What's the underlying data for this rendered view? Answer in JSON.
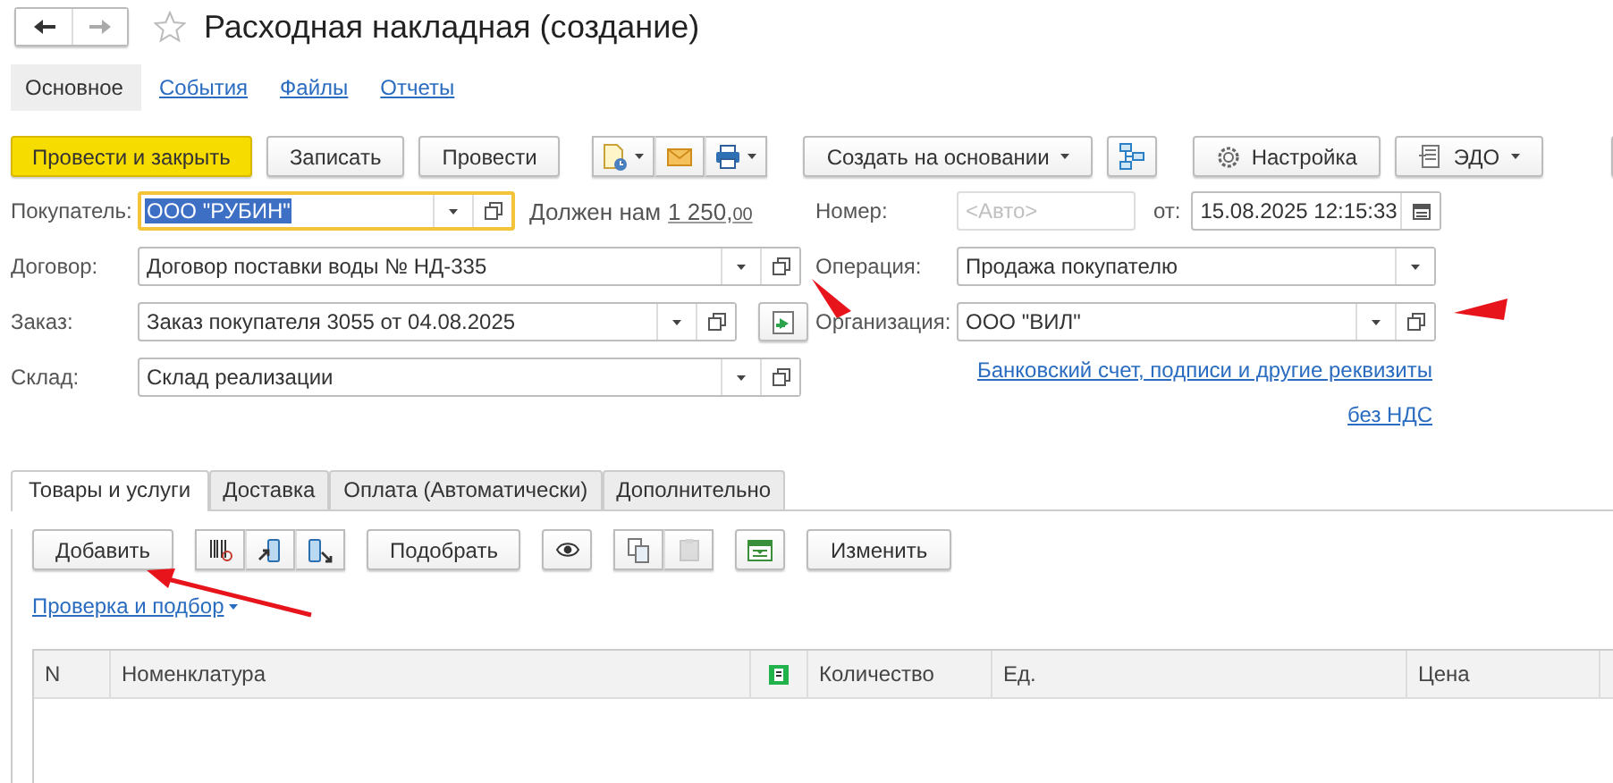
{
  "window": {
    "title": "Расходная накладная (создание)",
    "favorite": false
  },
  "nav_tabs": [
    {
      "label": "Основное",
      "selected": true
    },
    {
      "label": "События",
      "selected": false
    },
    {
      "label": "Файлы",
      "selected": false
    },
    {
      "label": "Отчеты",
      "selected": false
    }
  ],
  "toolbar": [
    {
      "kind": "primary",
      "label": "Провести и закрыть"
    },
    {
      "kind": "button",
      "label": "Записать"
    },
    {
      "kind": "button",
      "label": "Провести"
    },
    {
      "kind": "icon-group"
    },
    {
      "kind": "menu",
      "label": "Создать на основании"
    },
    {
      "kind": "structure"
    },
    {
      "kind": "settings",
      "label": "Настройка"
    },
    {
      "kind": "edo",
      "label": "ЭДО"
    },
    {
      "kind": "blank"
    }
  ],
  "left_fields": [
    {
      "label": "Покупатель:",
      "value": "ООО \"РУБИН\"",
      "focused": true,
      "selected": true,
      "dropdown": true,
      "open": true
    },
    {
      "label": "Договор:",
      "value": "Договор поставки воды № НД-335",
      "focused": false,
      "selected": false,
      "dropdown": true,
      "open": true,
      "arrow": true
    },
    {
      "label": "Заказ:",
      "value": "Заказ покупателя 3055 от 04.08.2025",
      "focused": false,
      "selected": false,
      "dropdown": true,
      "open": true
    },
    {
      "label": "Склад:",
      "value": "Склад реализации",
      "focused": false,
      "selected": false,
      "dropdown": true,
      "open": true
    }
  ],
  "debt": {
    "label": "Должен нам",
    "amount": "1 250,",
    "cents": "00"
  },
  "right_fields": [
    {
      "label": "Номер:",
      "placeholder": "<Авто>",
      "disabled": true,
      "date_label": "от:",
      "date": "15.08.2025 12:15:33"
    },
    {
      "label": "Операция:",
      "value": "Продажа покупателю",
      "dropdown": true
    },
    {
      "label": "Организация:",
      "value": "ООО \"ВИЛ\"",
      "dropdown": true,
      "open": true,
      "arrow": true
    }
  ],
  "links": [
    "Банковский счет, подписи и другие реквизиты",
    "без НДС"
  ],
  "tabs": [
    {
      "label": "Товары и услуги",
      "selected": true
    },
    {
      "label": "Доставка",
      "selected": false
    },
    {
      "label": "Оплата (Автоматически)",
      "selected": false
    },
    {
      "label": "Дополнительно",
      "selected": false
    }
  ],
  "table_toolbar": [
    {
      "kind": "button",
      "label": "Добавить",
      "arrow": true
    },
    {
      "kind": "scan-group"
    },
    {
      "kind": "button",
      "label": "Подобрать"
    },
    {
      "kind": "eye"
    },
    {
      "kind": "copy-group",
      "paste_disabled": true
    },
    {
      "kind": "table"
    },
    {
      "kind": "button",
      "label": "Изменить"
    }
  ],
  "check_link": {
    "label": "Проверка и подбор"
  },
  "table": {
    "columns": [
      {
        "kind": "text",
        "label": "N"
      },
      {
        "kind": "text",
        "label": "Номенклатура"
      },
      {
        "kind": "icon"
      },
      {
        "kind": "text",
        "label": "Количество"
      },
      {
        "kind": "text",
        "label": "Ед."
      },
      {
        "kind": "text",
        "label": "Цена"
      },
      {
        "kind": "blank"
      }
    ]
  }
}
